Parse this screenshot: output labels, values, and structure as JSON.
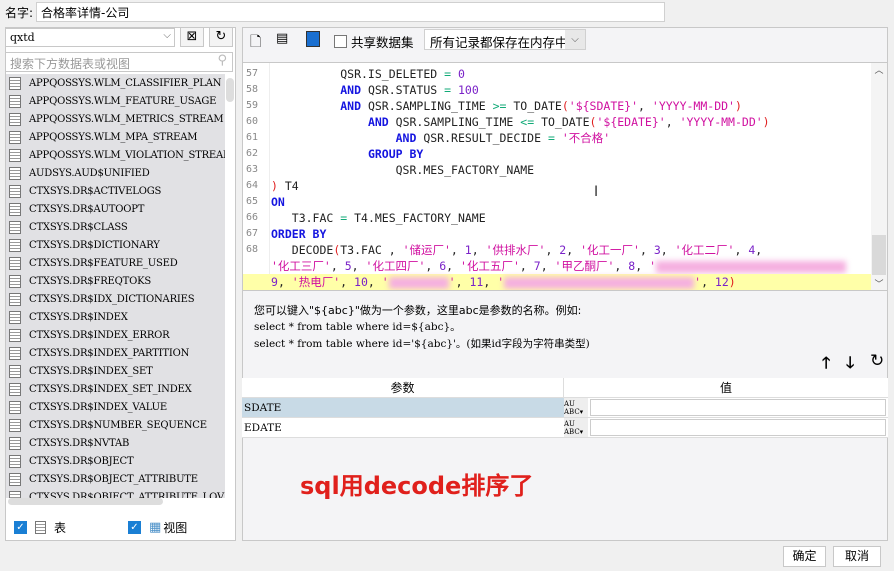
{
  "name_label": "名字:",
  "name_value": "合格率详情-公司",
  "left": {
    "schema": "qxtd",
    "search_placeholder": "搜索下方数据表或视图",
    "items": [
      "APPQOSSYS.WLM_CLASSIFIER_PLAN",
      "APPQOSSYS.WLM_FEATURE_USAGE",
      "APPQOSSYS.WLM_METRICS_STREAM",
      "APPQOSSYS.WLM_MPA_STREAM",
      "APPQOSSYS.WLM_VIOLATION_STREAM",
      "AUDSYS.AUD$UNIFIED",
      "CTXSYS.DR$ACTIVELOGS",
      "CTXSYS.DR$AUTOOPT",
      "CTXSYS.DR$CLASS",
      "CTXSYS.DR$DICTIONARY",
      "CTXSYS.DR$FEATURE_USED",
      "CTXSYS.DR$FREQTOKS",
      "CTXSYS.DR$IDX_DICTIONARIES",
      "CTXSYS.DR$INDEX",
      "CTXSYS.DR$INDEX_ERROR",
      "CTXSYS.DR$INDEX_PARTITION",
      "CTXSYS.DR$INDEX_SET",
      "CTXSYS.DR$INDEX_SET_INDEX",
      "CTXSYS.DR$INDEX_VALUE",
      "CTXSYS.DR$NUMBER_SEQUENCE",
      "CTXSYS.DR$NVTAB",
      "CTXSYS.DR$OBJECT",
      "CTXSYS.DR$OBJECT_ATTRIBUTE",
      "CTXSYS.DR$OBJECT_ATTRIBUTE_LOV"
    ],
    "show_tables_label": "表",
    "show_views_label": "视图"
  },
  "toolbar": {
    "share_label": "共享数据集",
    "storage_mode": "所有记录都保存在内存中"
  },
  "editor": {
    "lines": [
      {
        "n": "57",
        "t": [
          [
            "          QSR.IS_DELETED ",
            "pl"
          ],
          [
            "=",
            "op"
          ],
          [
            " ",
            "pl"
          ],
          [
            "0",
            "num-lit"
          ]
        ]
      },
      {
        "n": "58",
        "t": [
          [
            "          ",
            "pl"
          ],
          [
            "AND",
            "kw"
          ],
          [
            " QSR.STATUS ",
            "pl"
          ],
          [
            "=",
            "op"
          ],
          [
            " ",
            "pl"
          ],
          [
            "100",
            "num-lit"
          ]
        ]
      },
      {
        "n": "59",
        "t": [
          [
            "          ",
            "pl"
          ],
          [
            "AND",
            "kw"
          ],
          [
            " QSR.SAMPLING_TIME ",
            "pl"
          ],
          [
            ">=",
            "op"
          ],
          [
            " TO_DATE",
            "pl"
          ],
          [
            "(",
            "par"
          ],
          [
            "'${SDATE}'",
            "str"
          ],
          [
            ", ",
            "pl"
          ],
          [
            "'YYYY-MM-DD'",
            "str"
          ],
          [
            ")",
            "par"
          ]
        ]
      },
      {
        "n": "60",
        "t": [
          [
            "              ",
            "pl"
          ],
          [
            "AND",
            "kw"
          ],
          [
            " QSR.SAMPLING_TIME ",
            "pl"
          ],
          [
            "<=",
            "op"
          ],
          [
            " TO_DATE",
            "pl"
          ],
          [
            "(",
            "par"
          ],
          [
            "'${EDATE}'",
            "str"
          ],
          [
            ", ",
            "pl"
          ],
          [
            "'YYYY-MM-DD'",
            "str"
          ],
          [
            ")",
            "par"
          ]
        ]
      },
      {
        "n": "61",
        "t": [
          [
            "                  ",
            "pl"
          ],
          [
            "AND",
            "kw"
          ],
          [
            " QSR.RESULT_DECIDE ",
            "pl"
          ],
          [
            "=",
            "op"
          ],
          [
            " ",
            "pl"
          ],
          [
            "'不合格'",
            "str"
          ]
        ]
      },
      {
        "n": "62",
        "t": [
          [
            "              ",
            "pl"
          ],
          [
            "GROUP BY",
            "kw"
          ]
        ]
      },
      {
        "n": "63",
        "t": [
          [
            "                  QSR.MES_FACTORY_NAME",
            "pl"
          ]
        ]
      },
      {
        "n": "64",
        "t": [
          [
            ")",
            "par"
          ],
          [
            " T4",
            "pl"
          ]
        ]
      },
      {
        "n": "65",
        "t": [
          [
            "ON",
            "kw"
          ]
        ]
      },
      {
        "n": "66",
        "t": [
          [
            "   T3.FAC ",
            "pl"
          ],
          [
            "=",
            "op"
          ],
          [
            " T4.MES_FACTORY_NAME",
            "pl"
          ]
        ]
      },
      {
        "n": "67",
        "t": [
          [
            "ORDER BY",
            "kw"
          ]
        ]
      },
      {
        "n": "68",
        "t": [
          [
            "   DECODE",
            "pl"
          ],
          [
            "(",
            "par"
          ],
          [
            "T3.FAC , ",
            "pl"
          ],
          [
            "'储运厂'",
            "str"
          ],
          [
            ", ",
            "pl"
          ],
          [
            "1",
            "num-lit"
          ],
          [
            ", ",
            "pl"
          ],
          [
            "'供排水厂'",
            "str"
          ],
          [
            ", ",
            "pl"
          ],
          [
            "2",
            "num-lit"
          ],
          [
            ", ",
            "pl"
          ],
          [
            "'化工一厂'",
            "str"
          ],
          [
            ", ",
            "pl"
          ],
          [
            "3",
            "num-lit"
          ],
          [
            ", ",
            "pl"
          ],
          [
            "'化工二厂'",
            "str"
          ],
          [
            ", ",
            "pl"
          ],
          [
            "4",
            "num-lit"
          ],
          [
            ",",
            "pl"
          ]
        ]
      },
      {
        "n": "",
        "t": [
          [
            "'化工三厂'",
            "str"
          ],
          [
            ", ",
            "pl"
          ],
          [
            "5",
            "num-lit"
          ],
          [
            ", ",
            "pl"
          ],
          [
            "'化工四厂'",
            "str"
          ],
          [
            ", ",
            "pl"
          ],
          [
            "6",
            "num-lit"
          ],
          [
            ", ",
            "pl"
          ],
          [
            "'化工五厂'",
            "str"
          ],
          [
            ", ",
            "pl"
          ],
          [
            "7",
            "num-lit"
          ],
          [
            ", ",
            "pl"
          ],
          [
            "'甲乙酮厂'",
            "str"
          ],
          [
            ", ",
            "pl"
          ],
          [
            "8",
            "num-lit"
          ],
          [
            ", ",
            "pl"
          ],
          [
            "'",
            "str"
          ],
          [
            "__BLUR__",
            "blur"
          ]
        ]
      },
      {
        "n": "",
        "hl": true,
        "t": [
          [
            "9",
            "num-lit"
          ],
          [
            ", ",
            "pl"
          ],
          [
            "'热电厂'",
            "str"
          ],
          [
            ", ",
            "pl"
          ],
          [
            "10",
            "num-lit"
          ],
          [
            ", ",
            "pl"
          ],
          [
            "'",
            "str"
          ],
          [
            "__BLUR__",
            "blur"
          ],
          [
            "'",
            "str"
          ],
          [
            ", ",
            "pl"
          ],
          [
            "11",
            "num-lit"
          ],
          [
            ", ",
            "pl"
          ],
          [
            "'",
            "str"
          ],
          [
            "__BLUR__",
            "blur"
          ],
          [
            "'",
            "str"
          ],
          [
            ", ",
            "pl"
          ],
          [
            "12",
            "num-lit"
          ],
          [
            ")",
            "par"
          ]
        ]
      }
    ]
  },
  "hint": {
    "line1": "您可以键入\"${abc}\"做为一个参数，这里abc是参数的名称。例如:",
    "line2": "select * from table where id=${abc}。",
    "line3": "select * from table where id='${abc}'。(如果id字段为字符串类型)"
  },
  "params": {
    "col_param": "参数",
    "col_value": "值",
    "rows": [
      {
        "name": "SDATE",
        "value": ""
      },
      {
        "name": "EDATE",
        "value": ""
      }
    ]
  },
  "annotation": "sql用decode排序了",
  "buttons": {
    "ok": "确定",
    "cancel": "取消"
  }
}
